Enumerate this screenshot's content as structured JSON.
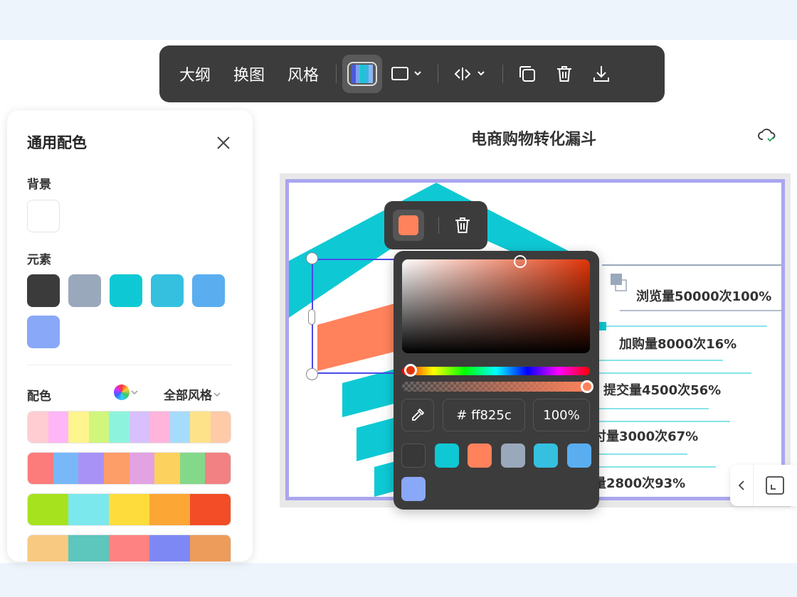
{
  "toolbar": {
    "outline_label": "大纲",
    "swap_label": "换图",
    "style_label": "风格"
  },
  "panel": {
    "title": "通用配色",
    "background_label": "背景",
    "background_color": "#ffffff",
    "elements_label": "元素",
    "element_colors": [
      "#3b3b3b",
      "#9aa8bb",
      "#0ec9d4",
      "#35c0e0",
      "#5aaef0",
      "#8aa8f8"
    ],
    "palette_label": "配色",
    "style_filter": "全部风格",
    "palettes": [
      [
        "#ffcdd2",
        "#ffb6f6",
        "#fff58f",
        "#d0f67c",
        "#8ef3dc",
        "#d7c0fb",
        "#ffb4dc",
        "#a6dcfb",
        "#fee28a",
        "#ffcaa8"
      ],
      [
        "#fb7c7b",
        "#78b8f9",
        "#a992f6",
        "#fd9d68",
        "#e3a2e2",
        "#fdd15d",
        "#84d88a",
        "#f28183"
      ],
      [
        "#a6e31e",
        "#7be8ee",
        "#fddc3b",
        "#fca635",
        "#f24d26"
      ],
      [
        "#f8c981",
        "#5dc6bd",
        "#fe8282",
        "#7e88f5",
        "#ed9c5b"
      ]
    ]
  },
  "chart": {
    "title": "电商购物转化漏斗",
    "labels": [
      "浏览量50000次100%",
      "加购量8000次16%",
      "提交量4500次56%",
      "付量3000次67%",
      "量2800次93%"
    ]
  },
  "picker": {
    "hex_value": "# ff825c",
    "opacity_value": "100%",
    "selected_color": "#ff825c",
    "swatches": [
      "#383838",
      "#0ec9d4",
      "#ff825c",
      "#9aa8bb",
      "#35c0e0",
      "#5aaef0",
      "#8aa8f8"
    ]
  }
}
